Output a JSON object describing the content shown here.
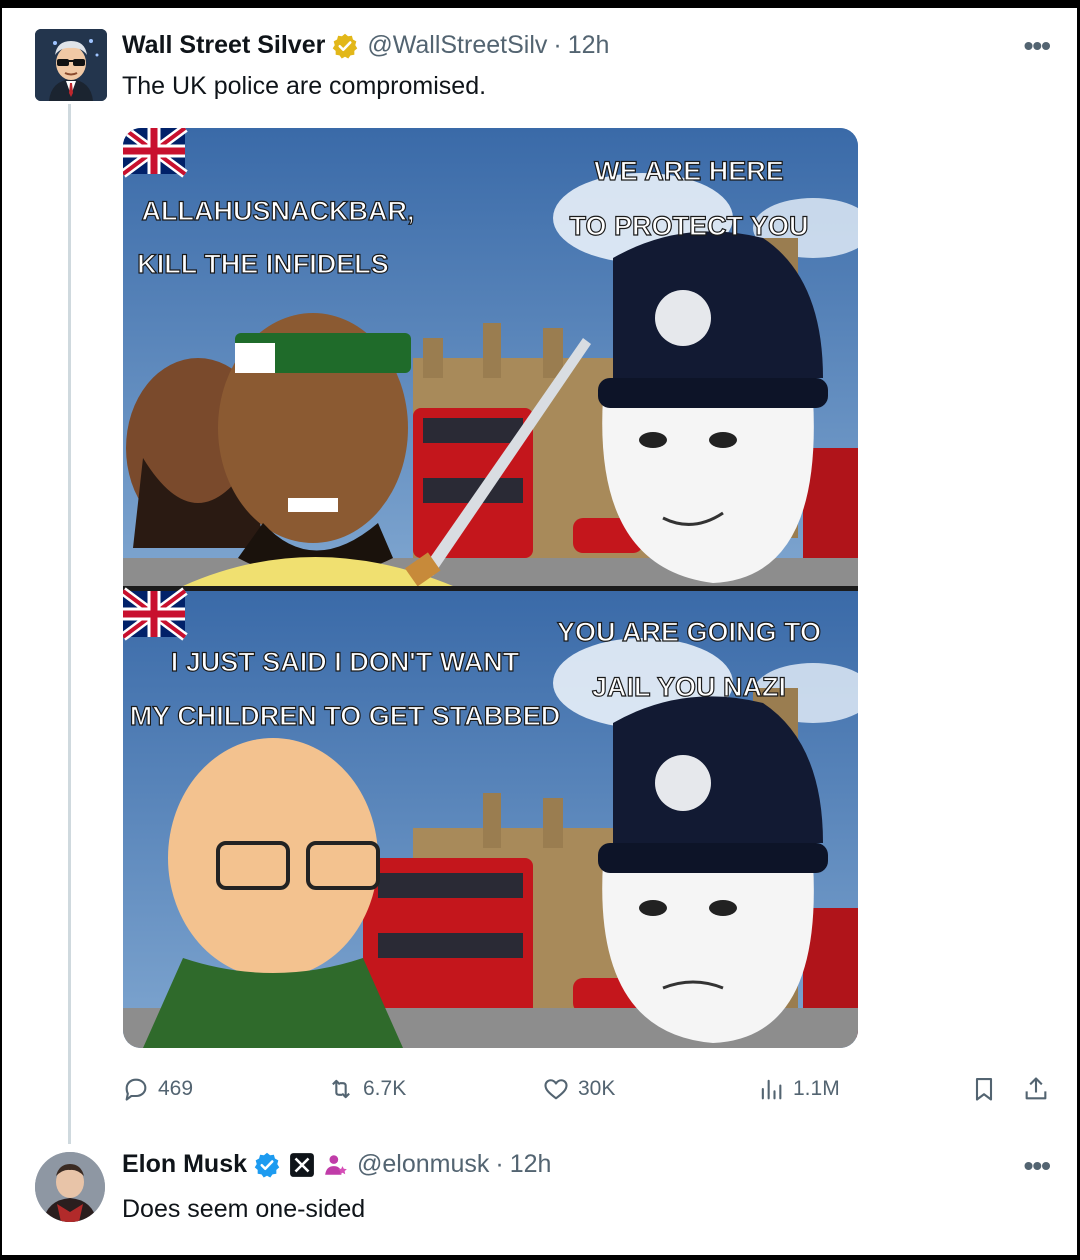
{
  "tweet": {
    "author_name": "Wall Street Silver",
    "handle": "@WallStreetSilv",
    "separator": "·",
    "time": "12h",
    "text": "The UK police are compromised.",
    "more_icon": "more-icon",
    "verified_color": "#e2b719",
    "meme": {
      "panel1_left_caption": [
        "ALLAHUSNACKBAR,",
        "KILL THE INFIDELS"
      ],
      "panel1_right_caption": [
        "WE ARE HERE",
        "TO PROTECT YOU"
      ],
      "panel2_left_caption": [
        "I JUST SAID I DON'T WANT",
        "MY CHILDREN TO GET STABBED"
      ],
      "panel2_right_caption": [
        "YOU ARE GOING TO",
        "JAIL YOU NAZI"
      ]
    },
    "stats": {
      "replies": "469",
      "retweets": "6.7K",
      "likes": "30K",
      "views": "1.1M"
    }
  },
  "reply": {
    "author_name": "Elon Musk",
    "handle": "@elonmusk",
    "separator": "·",
    "time": "12h",
    "text": "Does seem one-sided",
    "verified_color": "#1d9bf0"
  },
  "colors": {
    "text_primary": "#0f1419",
    "text_secondary": "#536471",
    "thread_line": "#cfd9de"
  }
}
